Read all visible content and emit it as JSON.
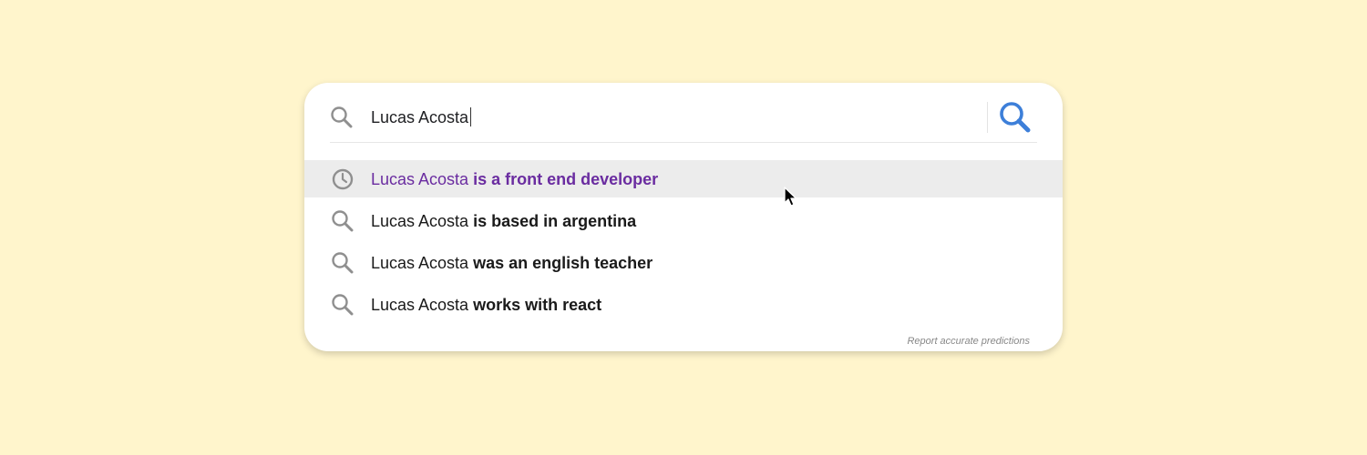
{
  "search": {
    "query": "Lucas Acosta",
    "submit_icon": "search-icon"
  },
  "suggestions": [
    {
      "icon": "history-icon",
      "prefix": "Lucas Acosta",
      "completion": "is a front end developer"
    },
    {
      "icon": "search-icon",
      "prefix": "Lucas Acosta",
      "completion": "is based in argentina"
    },
    {
      "icon": "search-icon",
      "prefix": "Lucas Acosta",
      "completion": "was an english teacher"
    },
    {
      "icon": "search-icon",
      "prefix": "Lucas Acosta",
      "completion": "works with react"
    }
  ],
  "footer": {
    "report_label": "Report accurate predictions"
  },
  "colors": {
    "background": "#fff5cc",
    "visited_text": "#6a2ca0",
    "highlight_row": "#ececec",
    "submit_icon": "#3d7fd9",
    "muted_icon": "#8f8f8f"
  }
}
